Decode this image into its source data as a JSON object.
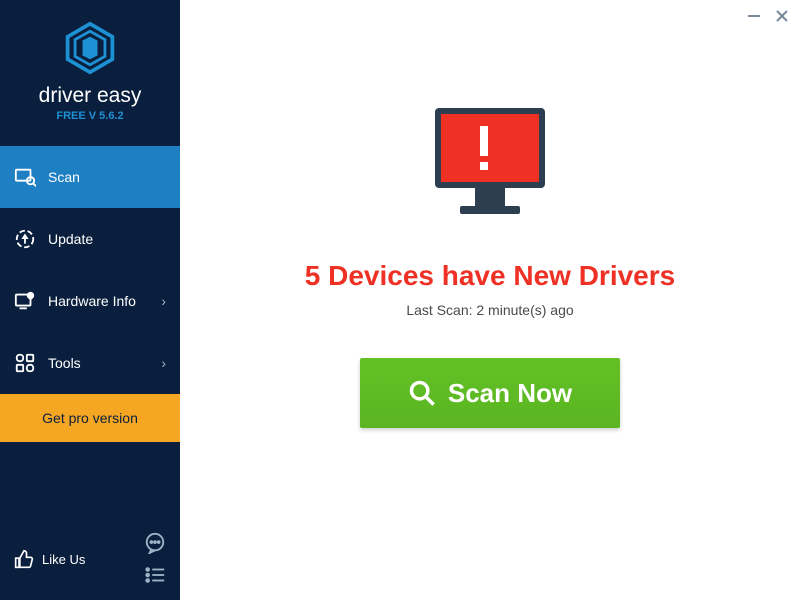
{
  "brand": {
    "name": "driver easy",
    "version": "FREE V 5.6.2"
  },
  "sidebar": {
    "items": [
      {
        "label": "Scan"
      },
      {
        "label": "Update"
      },
      {
        "label": "Hardware Info"
      },
      {
        "label": "Tools"
      }
    ],
    "pro_label": "Get pro version",
    "like_label": "Like Us"
  },
  "main": {
    "headline": "5 Devices have New Drivers",
    "subtext": "Last Scan: 2 minute(s) ago",
    "scan_button": "Scan Now"
  }
}
